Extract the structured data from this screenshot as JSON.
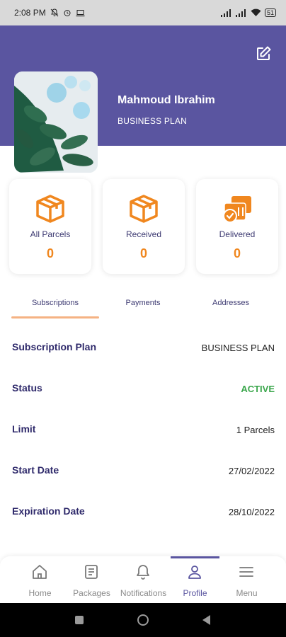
{
  "status_bar": {
    "time": "2:08 PM",
    "battery": "51"
  },
  "profile": {
    "name": "Mahmoud Ibrahim",
    "plan": "BUSINESS PLAN"
  },
  "stats": [
    {
      "label": "All Parcels",
      "count": "0",
      "icon": "box-icon"
    },
    {
      "label": "Received",
      "count": "0",
      "icon": "open-box-icon"
    },
    {
      "label": "Delivered",
      "count": "0",
      "icon": "delivered-boxes-icon"
    }
  ],
  "tabs": [
    {
      "label": "Subscriptions",
      "active": true
    },
    {
      "label": "Payments",
      "active": false
    },
    {
      "label": "Addresses",
      "active": false
    }
  ],
  "subscription": {
    "rows": [
      {
        "label": "Subscription Plan",
        "value": "BUSINESS PLAN"
      },
      {
        "label": "Status",
        "value": "ACTIVE"
      },
      {
        "label": "Limit",
        "value": "1 Parcels"
      },
      {
        "label": "Start Date",
        "value": "27/02/2022"
      },
      {
        "label": "Expiration Date",
        "value": "28/10/2022"
      }
    ]
  },
  "bottom_nav": [
    {
      "label": "Home",
      "icon": "home-icon"
    },
    {
      "label": "Packages",
      "icon": "packages-icon"
    },
    {
      "label": "Notifications",
      "icon": "bell-icon"
    },
    {
      "label": "Profile",
      "icon": "person-icon",
      "active": true
    },
    {
      "label": "Menu",
      "icon": "menu-icon"
    }
  ],
  "colors": {
    "header": "#5a55a0",
    "accent": "#f0871f",
    "active_status": "#3aa64b",
    "label_text": "#2f2a6b"
  }
}
